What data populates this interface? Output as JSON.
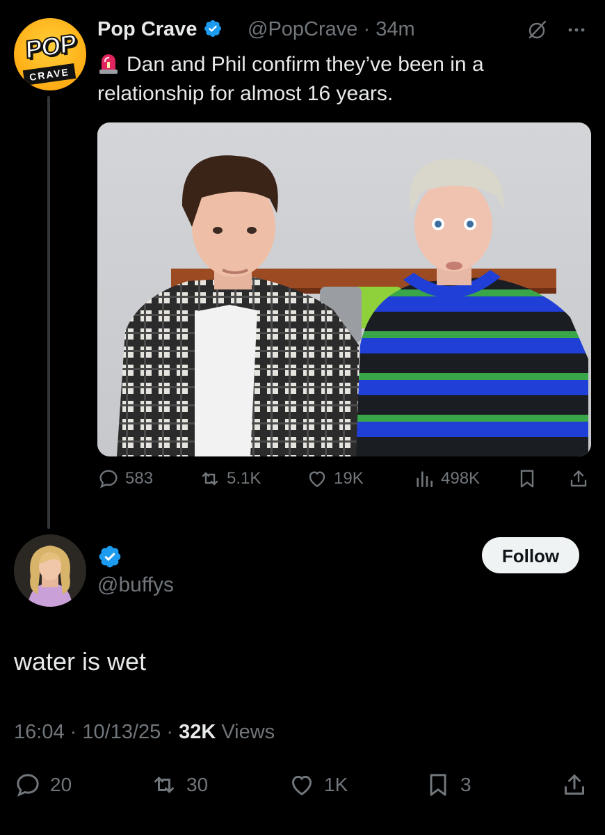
{
  "tweet": {
    "author_name": "Pop Crave",
    "handle": "@PopCrave",
    "separator": "·",
    "time": "34m",
    "text": "Dan and Phil confirm they’ve been in a relationship for almost 16 years.",
    "avatar_text_top": "POP",
    "avatar_text_bottom": "CRAVE",
    "metrics": {
      "replies": "583",
      "reposts": "5.1K",
      "likes": "19K",
      "views": "498K"
    }
  },
  "reply": {
    "handle": "@buffys",
    "follow_label": "Follow",
    "text": "water is wet",
    "time": "16:04",
    "date": "10/13/25",
    "views_count": "32K",
    "views_label": "Views",
    "separator": "·",
    "metrics": {
      "replies": "20",
      "reposts": "30",
      "likes": "1K",
      "bookmarks": "3"
    }
  },
  "colors": {
    "background": "#000000",
    "text": "#e7e9ea",
    "muted": "#71767b",
    "verified": "#1d9bf0"
  },
  "icons": [
    "verified-badge-icon",
    "siren-icon",
    "grok-icon",
    "more-icon",
    "reply-icon",
    "repost-icon",
    "like-icon",
    "views-icon",
    "bookmark-icon",
    "share-icon"
  ]
}
